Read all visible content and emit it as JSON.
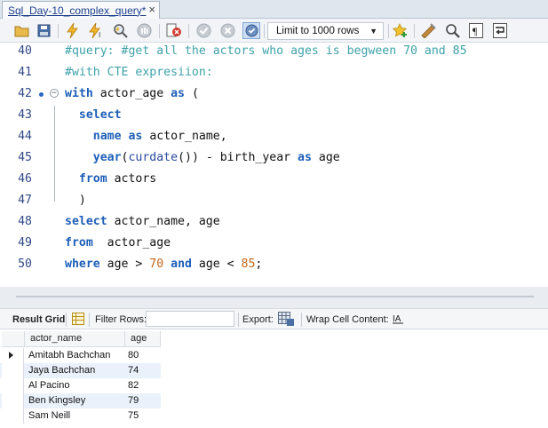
{
  "tab": {
    "title": "Sql_Day-10_complex_query*",
    "close": "×"
  },
  "toolbar": {
    "limit_label": "Limit to 1000 rows",
    "icons": [
      "folder-open-icon",
      "save-icon",
      "execute-icon",
      "execute-statement-icon",
      "explain-icon",
      "stop-icon",
      "toggle-error-icon",
      "commit-icon",
      "rollback-icon",
      "autocommit-icon",
      "limit-select",
      "bookmark-icon",
      "beautify-icon",
      "find-icon",
      "invisible-chars-icon",
      "wrap-icon"
    ]
  },
  "editor": {
    "lines": [
      {
        "num": "40",
        "tokens": [
          {
            "t": "#query: #get all the actors who ages is begween 70 and 85",
            "c": "cm"
          }
        ]
      },
      {
        "num": "41",
        "tokens": [
          {
            "t": "#with CTE expresiion:",
            "c": "cm"
          }
        ]
      },
      {
        "num": "42",
        "tokens": [
          {
            "t": "with",
            "c": "kw"
          },
          {
            "t": " actor_age ",
            "c": ""
          },
          {
            "t": "as",
            "c": "kw"
          },
          {
            "t": " (",
            "c": ""
          }
        ]
      },
      {
        "num": "43",
        "tokens": [
          {
            "t": "  ",
            "c": ""
          },
          {
            "t": "select",
            "c": "kw"
          }
        ]
      },
      {
        "num": "44",
        "tokens": [
          {
            "t": "    ",
            "c": ""
          },
          {
            "t": "name",
            "c": "kw"
          },
          {
            "t": " ",
            "c": ""
          },
          {
            "t": "as",
            "c": "kw"
          },
          {
            "t": " actor_name,",
            "c": ""
          }
        ]
      },
      {
        "num": "45",
        "tokens": [
          {
            "t": "    ",
            "c": ""
          },
          {
            "t": "year",
            "c": "kw"
          },
          {
            "t": "(",
            "c": ""
          },
          {
            "t": "curdate",
            "c": "fn"
          },
          {
            "t": "()) - birth_year ",
            "c": ""
          },
          {
            "t": "as",
            "c": "kw"
          },
          {
            "t": " age",
            "c": ""
          }
        ]
      },
      {
        "num": "46",
        "tokens": [
          {
            "t": "  ",
            "c": ""
          },
          {
            "t": "from",
            "c": "kw"
          },
          {
            "t": " actors",
            "c": ""
          }
        ]
      },
      {
        "num": "47",
        "tokens": [
          {
            "t": "  )",
            "c": ""
          }
        ]
      },
      {
        "num": "48",
        "tokens": [
          {
            "t": "select",
            "c": "kw"
          },
          {
            "t": " actor_name, age",
            "c": ""
          }
        ]
      },
      {
        "num": "49",
        "tokens": [
          {
            "t": "from",
            "c": "kw"
          },
          {
            "t": "  actor_age",
            "c": ""
          }
        ]
      },
      {
        "num": "50",
        "tokens": [
          {
            "t": "where",
            "c": "kw"
          },
          {
            "t": " age > ",
            "c": ""
          },
          {
            "t": "70",
            "c": "num"
          },
          {
            "t": " ",
            "c": ""
          },
          {
            "t": "and",
            "c": "kw"
          },
          {
            "t": " age < ",
            "c": ""
          },
          {
            "t": "85",
            "c": "num"
          },
          {
            "t": ";",
            "c": ""
          }
        ]
      }
    ]
  },
  "results_toolbar": {
    "result_grid": "Result Grid",
    "filter_rows": "Filter Rows:",
    "filter_value": "",
    "export": "Export:",
    "wrap": "Wrap Cell Content:"
  },
  "result_grid": {
    "columns": [
      "actor_name",
      "age"
    ],
    "rows": [
      [
        "Amitabh Bachchan",
        "80"
      ],
      [
        "Jaya Bachchan",
        "74"
      ],
      [
        "Al Pacino",
        "82"
      ],
      [
        "Ben Kingsley",
        "79"
      ],
      [
        "Sam Neill",
        "75"
      ]
    ]
  },
  "colors": {
    "keyword": "#1d5fb8",
    "comment": "#3ea2a8",
    "number": "#c4651a",
    "line_number": "#2f4a86",
    "row_highlight": "#eaf1fb"
  }
}
